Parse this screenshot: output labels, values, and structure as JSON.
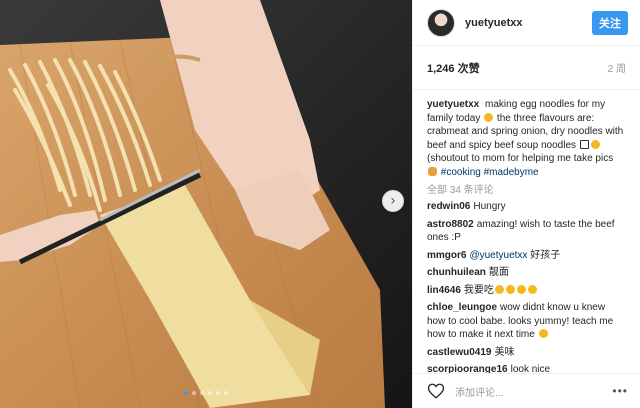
{
  "post": {
    "username": "yuetyuetxx",
    "follow_label": "关注",
    "likes": "1,246 次赞",
    "age": "2 周"
  },
  "caption": {
    "username": "yuetyuetxx",
    "text_1": "making egg noodles for my family today",
    "text_2": "the three flavours are: crabmeat and spring onion, dry noodles with beef and spicy beef soup noodles",
    "text_3": "(shoutout to mom for helping me take pics",
    "hashtag_1": "#cooking",
    "hashtag_2": "#madebyme"
  },
  "view_all": "全部 34 条评论",
  "comments": [
    {
      "user": "redwin06",
      "text": "Hungry"
    },
    {
      "user": "astro8802",
      "text": "amazing! wish to taste the beef ones :P"
    },
    {
      "user": "mmgor6",
      "mention": "@yuetyuetxx",
      "text": "好孩子"
    },
    {
      "user": "chunhuilean",
      "text": "靓面"
    },
    {
      "user": "lin4646",
      "text": "我要吃"
    },
    {
      "user": "chloe_leungoe",
      "text": "wow didnt know u knew how to cool babe. looks yummy! teach me how to make it next time"
    },
    {
      "user": "castlewu0419",
      "text": "美味"
    },
    {
      "user": "scorpioorange16",
      "text": "look nice"
    }
  ],
  "footer": {
    "placeholder": "添加评论...",
    "more": "•••"
  },
  "icons": {
    "next": "chevron-right-icon",
    "like": "heart-icon",
    "options": "more-options-icon"
  },
  "colors": {
    "accent": "#3897f0",
    "hashtag": "#003569"
  }
}
